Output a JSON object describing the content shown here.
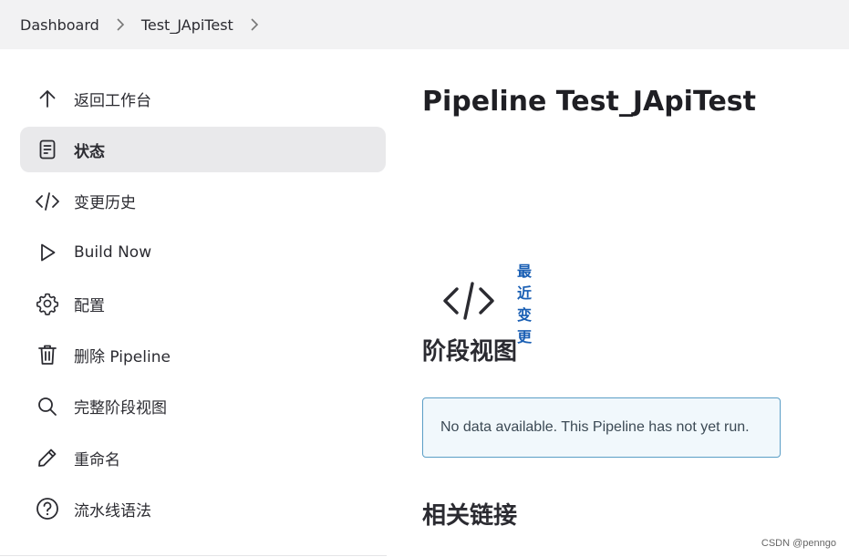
{
  "breadcrumb": {
    "items": [
      "Dashboard",
      "Test_JApiTest"
    ]
  },
  "sidebar": {
    "items": [
      {
        "label": "返回工作台",
        "icon": "arrow-up-icon"
      },
      {
        "label": "状态",
        "icon": "document-icon"
      },
      {
        "label": "变更历史",
        "icon": "code-icon"
      },
      {
        "label": "Build Now",
        "icon": "play-icon"
      },
      {
        "label": "配置",
        "icon": "gear-icon"
      },
      {
        "label": "删除 Pipeline",
        "icon": "trash-icon"
      },
      {
        "label": "完整阶段视图",
        "icon": "search-icon"
      },
      {
        "label": "重命名",
        "icon": "pencil-icon"
      },
      {
        "label": "流水线语法",
        "icon": "help-icon"
      }
    ],
    "active_index": 1
  },
  "main": {
    "title": "Pipeline Test_JApiTest",
    "recent_changes_label": "最近变更",
    "stage_view_title": "阶段视图",
    "notice": "No data available. This Pipeline has not yet run.",
    "related_links_title": "相关链接"
  },
  "watermark": "CSDN @penngo",
  "colors": {
    "link": "#1a5fb4",
    "active_bg": "#e9e9eb",
    "notice_border": "#5a9ec6",
    "notice_bg": "#f1f8fc"
  }
}
